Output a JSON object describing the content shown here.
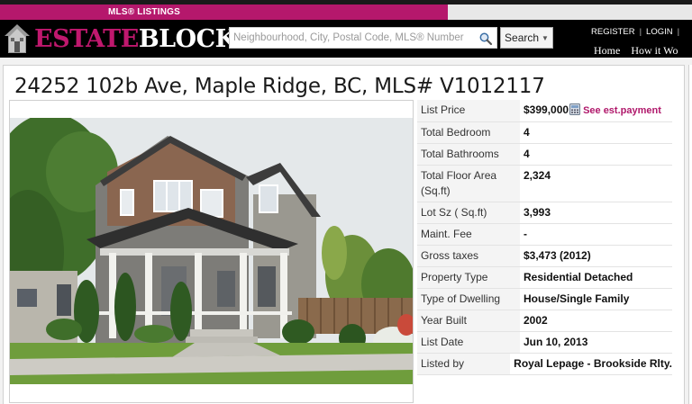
{
  "brand": {
    "mls_tab": "MLS® LISTINGS",
    "logo_part1": "ESTATE",
    "logo_part2": "BLOCK",
    "accent": "#b5186c"
  },
  "search": {
    "placeholder": "Neighbourhood, City, Postal Code, MLS® Number",
    "button_label": "Search",
    "icon": "search-icon"
  },
  "account_links": [
    "REGISTER",
    "LOGIN"
  ],
  "nav": [
    "Home",
    "How it Wo"
  ],
  "listing": {
    "title": "24252 102b Ave, Maple Ridge, BC, MLS# V1012117",
    "est_payment_label": "See est.payment",
    "details": [
      {
        "label": "List Price",
        "value": "$399,000"
      },
      {
        "label": "Total Bedroom",
        "value": "4"
      },
      {
        "label": "Total Bathrooms",
        "value": "4"
      },
      {
        "label": "Total Floor Area (Sq.ft)",
        "value": "2,324"
      },
      {
        "label": "Lot Sz ( Sq.ft)",
        "value": "3,993"
      },
      {
        "label": "Maint. Fee",
        "value": "-"
      },
      {
        "label": "Gross taxes",
        "value": "$3,473 (2012)"
      },
      {
        "label": "Property Type",
        "value": "Residential Detached"
      },
      {
        "label": "Type of Dwelling",
        "value": "House/Single Family"
      },
      {
        "label": "Year Built",
        "value": "2002"
      },
      {
        "label": "List Date",
        "value": "Jun 10, 2013"
      },
      {
        "label": "Listed by",
        "value": "Royal Lepage - Brookside Rlty."
      }
    ]
  }
}
